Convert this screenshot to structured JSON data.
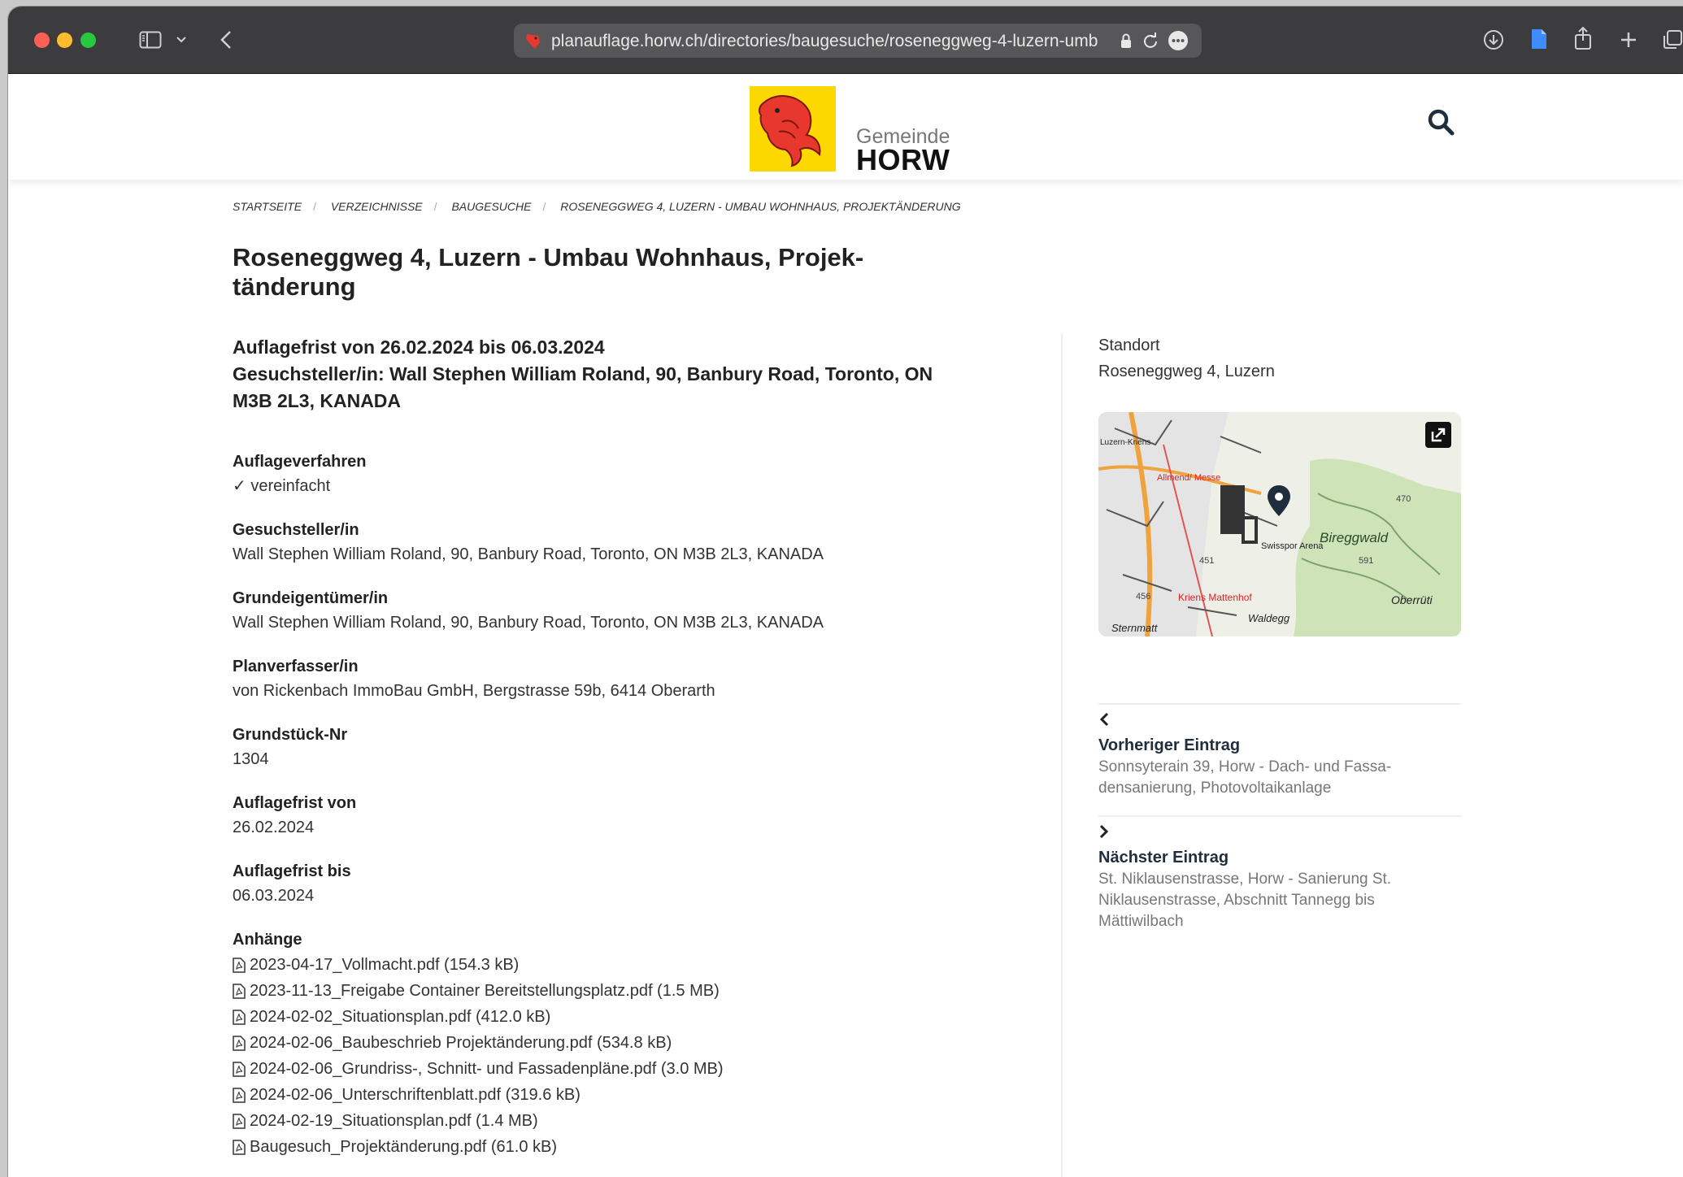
{
  "browser": {
    "url": "planauflage.horw.ch/directories/baugesuche/roseneggweg-4-luzern-umb"
  },
  "header": {
    "logo_small": "Gemeinde",
    "logo_big": "HORW"
  },
  "breadcrumb": {
    "items": [
      "STARTSEITE",
      "VERZEICHNISSE",
      "BAUGESUCHE",
      "ROSENEGGWEG 4, LUZERN - UMBAU WOHNHAUS, PROJEKTÄNDERUNG"
    ]
  },
  "page": {
    "title": "Roseneggweg 4, Luzern - Umbau Wohnhaus, Projek­tänderung",
    "lead_1": "Auflagefrist von 26.02.2024 bis 06.03.2024",
    "lead_2": "Gesuchsteller/in: Wall Stephen William Roland, 90, Banbury Road, To­ronto, ON M3B 2L3, KANADA"
  },
  "fields": [
    {
      "label": "Auflageverfahren",
      "value": "✓ vereinfacht"
    },
    {
      "label": "Gesuchsteller/in",
      "value": "Wall Stephen William Roland, 90, Banbury Road, Toronto, ON M3B 2L3, KANADA"
    },
    {
      "label": "Grundeigentümer/in",
      "value": "Wall Stephen William Roland, 90, Banbury Road, Toronto, ON M3B 2L3, KANADA"
    },
    {
      "label": "Planverfasser/in",
      "value": "von Rickenbach ImmoBau GmbH, Bergstrasse 59b, 6414 Oberarth"
    },
    {
      "label": "Grundstück-Nr",
      "value": "1304"
    },
    {
      "label": "Auflagefrist von",
      "value": "26.02.2024"
    },
    {
      "label": "Auflagefrist bis",
      "value": "06.03.2024"
    }
  ],
  "attachments": {
    "label": "Anhänge",
    "items": [
      "2023-04-17_Vollmacht.pdf (154.3 kB)",
      "2023-11-13_Freigabe Container Bereitstellungsplatz.pdf (1.5 MB)",
      "2024-02-02_Situationsplan.pdf (412.0 kB)",
      "2024-02-06_Baubeschrieb Projektänderung.pdf (534.8 kB)",
      "2024-02-06_Grundriss-, Schnitt- und Fassadenpläne.pdf (3.0 MB)",
      "2024-02-06_Unterschriftenblatt.pdf (319.6 kB)",
      "2024-02-19_Situationsplan.pdf (1.4 MB)",
      "Baugesuch_Projektänderung.pdf (61.0 kB)"
    ]
  },
  "sidebar": {
    "location_label": "Standort",
    "location_value": "Roseneggweg 4, Luzern",
    "map_labels": [
      "Luzern-Kriens",
      "Allmend/ Messe",
      "Swisspor Arena",
      "Bireggwald",
      "Kriens Mattenhof",
      "Waldegg",
      "Oberrüti",
      "Sternmatt",
      "470",
      "591",
      "451",
      "456"
    ],
    "prev": {
      "heading": "Vorheriger Eintrag",
      "text": "Sonnsyterain 39, Horw - Dach- und Fassa­densanierung, Photovoltaikanlage"
    },
    "next": {
      "heading": "Nächster Eintrag",
      "text": "St. Niklausenstrasse, Horw - Sanierung St. Niklausenstrasse, Abschnitt Tannegg bis Mättiwilbach"
    }
  },
  "colors": {
    "accent": "#fcd800",
    "logo_red": "#e8382d",
    "link": "#1f2d3d"
  }
}
